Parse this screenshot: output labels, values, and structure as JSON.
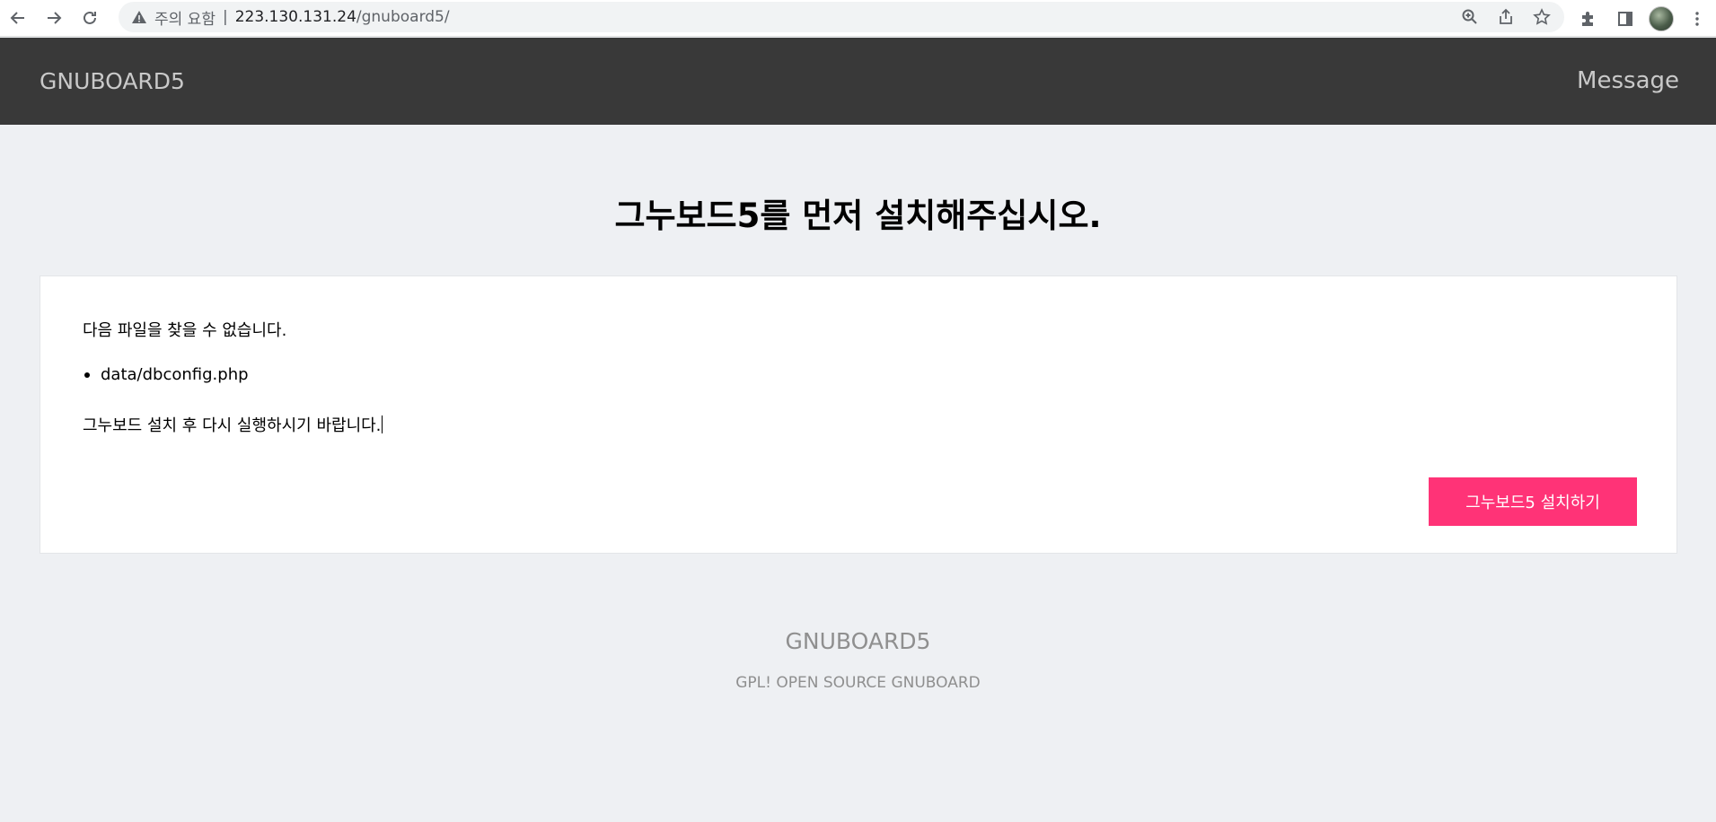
{
  "browser": {
    "security_label": "주의 요함",
    "separator": "|",
    "url_host": "223.130.131.24",
    "url_path": "/gnuboard5/"
  },
  "header": {
    "logo": "GNUBOARD5",
    "message_link": "Message"
  },
  "main": {
    "title": "그누보드5를 먼저 설치해주십시오.",
    "intro_text": "다음 파일을 찾을 수 없습니다.",
    "missing_files": [
      "data/dbconfig.php"
    ],
    "instruction_text": "그누보드 설치 후 다시 실행하시기 바랍니다.",
    "install_button": "그누보드5 설치하기"
  },
  "footer": {
    "logo": "GNUBOARD5",
    "tagline": "GPL! OPEN SOURCE GNUBOARD"
  },
  "colors": {
    "header_bg": "#393939",
    "page_bg": "#eef0f3",
    "install_button_bg": "#ff3377"
  }
}
